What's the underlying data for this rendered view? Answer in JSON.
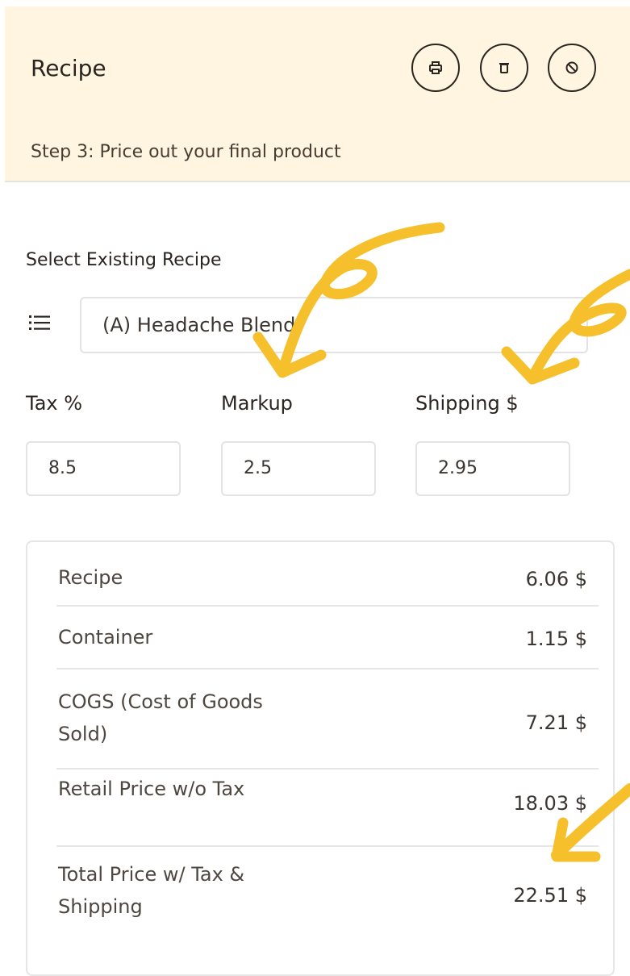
{
  "header": {
    "title": "Recipe",
    "step": "Step 3: Price out your final product",
    "buttons": [
      {
        "icon": "print-icon"
      },
      {
        "icon": "trash-icon"
      },
      {
        "icon": "cancel-icon"
      }
    ]
  },
  "recipe_select": {
    "label": "Select Existing Recipe",
    "value": "(A) Headache Blend",
    "icon": "list-icon"
  },
  "fields": [
    {
      "label": "Tax %",
      "value": "8.5"
    },
    {
      "label": "Markup",
      "value": "2.5"
    },
    {
      "label": "Shipping $",
      "value": "2.95"
    }
  ],
  "summary": [
    {
      "label": "Recipe",
      "value": "6.06 $"
    },
    {
      "label": "Container",
      "value": "1.15 $"
    },
    {
      "label": "COGS (Cost of Goods Sold)",
      "value": "7.21 $"
    },
    {
      "label": "Retail Price w/o Tax",
      "value": "18.03 $"
    },
    {
      "label": "Total Price w/ Tax & Shipping",
      "value": "22.51 $"
    }
  ],
  "colors": {
    "header_bg": "#fff5e1",
    "annotation_arrow": "#f5c02c"
  }
}
